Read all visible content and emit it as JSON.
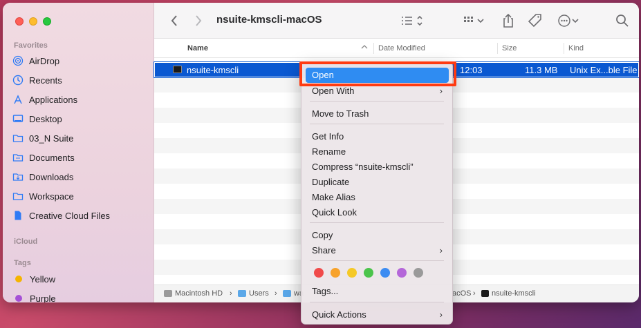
{
  "window": {
    "title": "nsuite-kmscli-macOS"
  },
  "sidebar": {
    "favorites_label": "Favorites",
    "favorites": [
      {
        "label": "AirDrop",
        "icon": "airdrop-icon"
      },
      {
        "label": "Recents",
        "icon": "clock-icon"
      },
      {
        "label": "Applications",
        "icon": "applications-icon"
      },
      {
        "label": "Desktop",
        "icon": "desktop-icon"
      },
      {
        "label": "03_N Suite",
        "icon": "folder-icon"
      },
      {
        "label": "Documents",
        "icon": "document-icon"
      },
      {
        "label": "Downloads",
        "icon": "download-icon"
      },
      {
        "label": "Workspace",
        "icon": "folder-icon"
      },
      {
        "label": "Creative Cloud Files",
        "icon": "file-icon"
      }
    ],
    "icloud_label": "iCloud",
    "tags_label": "Tags",
    "tags": [
      {
        "label": "Yellow",
        "color": "#f5b400"
      },
      {
        "label": "Purple",
        "color": "#a550d6"
      }
    ]
  },
  "columns": {
    "name": "Name",
    "date": "Date Modified",
    "size": "Size",
    "kind": "Kind"
  },
  "file": {
    "name": "nsuite-kmscli",
    "date": "12:03",
    "size": "11.3 MB",
    "kind": "Unix Ex...ble File"
  },
  "pathbar": {
    "segments": [
      "Macintosh HD",
      "Users",
      "wa",
      "acOS",
      "nsuite-kmscli"
    ]
  },
  "menu": {
    "open": "Open",
    "open_with": "Open With",
    "move_to_trash": "Move to Trash",
    "get_info": "Get Info",
    "rename": "Rename",
    "compress": "Compress “nsuite-kmscli”",
    "duplicate": "Duplicate",
    "make_alias": "Make Alias",
    "quick_look": "Quick Look",
    "copy": "Copy",
    "share": "Share",
    "tag_colors": [
      "#f04a4a",
      "#f7a22b",
      "#f5c927",
      "#4bc44b",
      "#3c8cf2",
      "#b467d9",
      "#9a9a9a"
    ],
    "tags": "Tags...",
    "quick_actions": "Quick Actions"
  },
  "accent": "#0a58d1",
  "highlight_frame": "#ff3b12"
}
